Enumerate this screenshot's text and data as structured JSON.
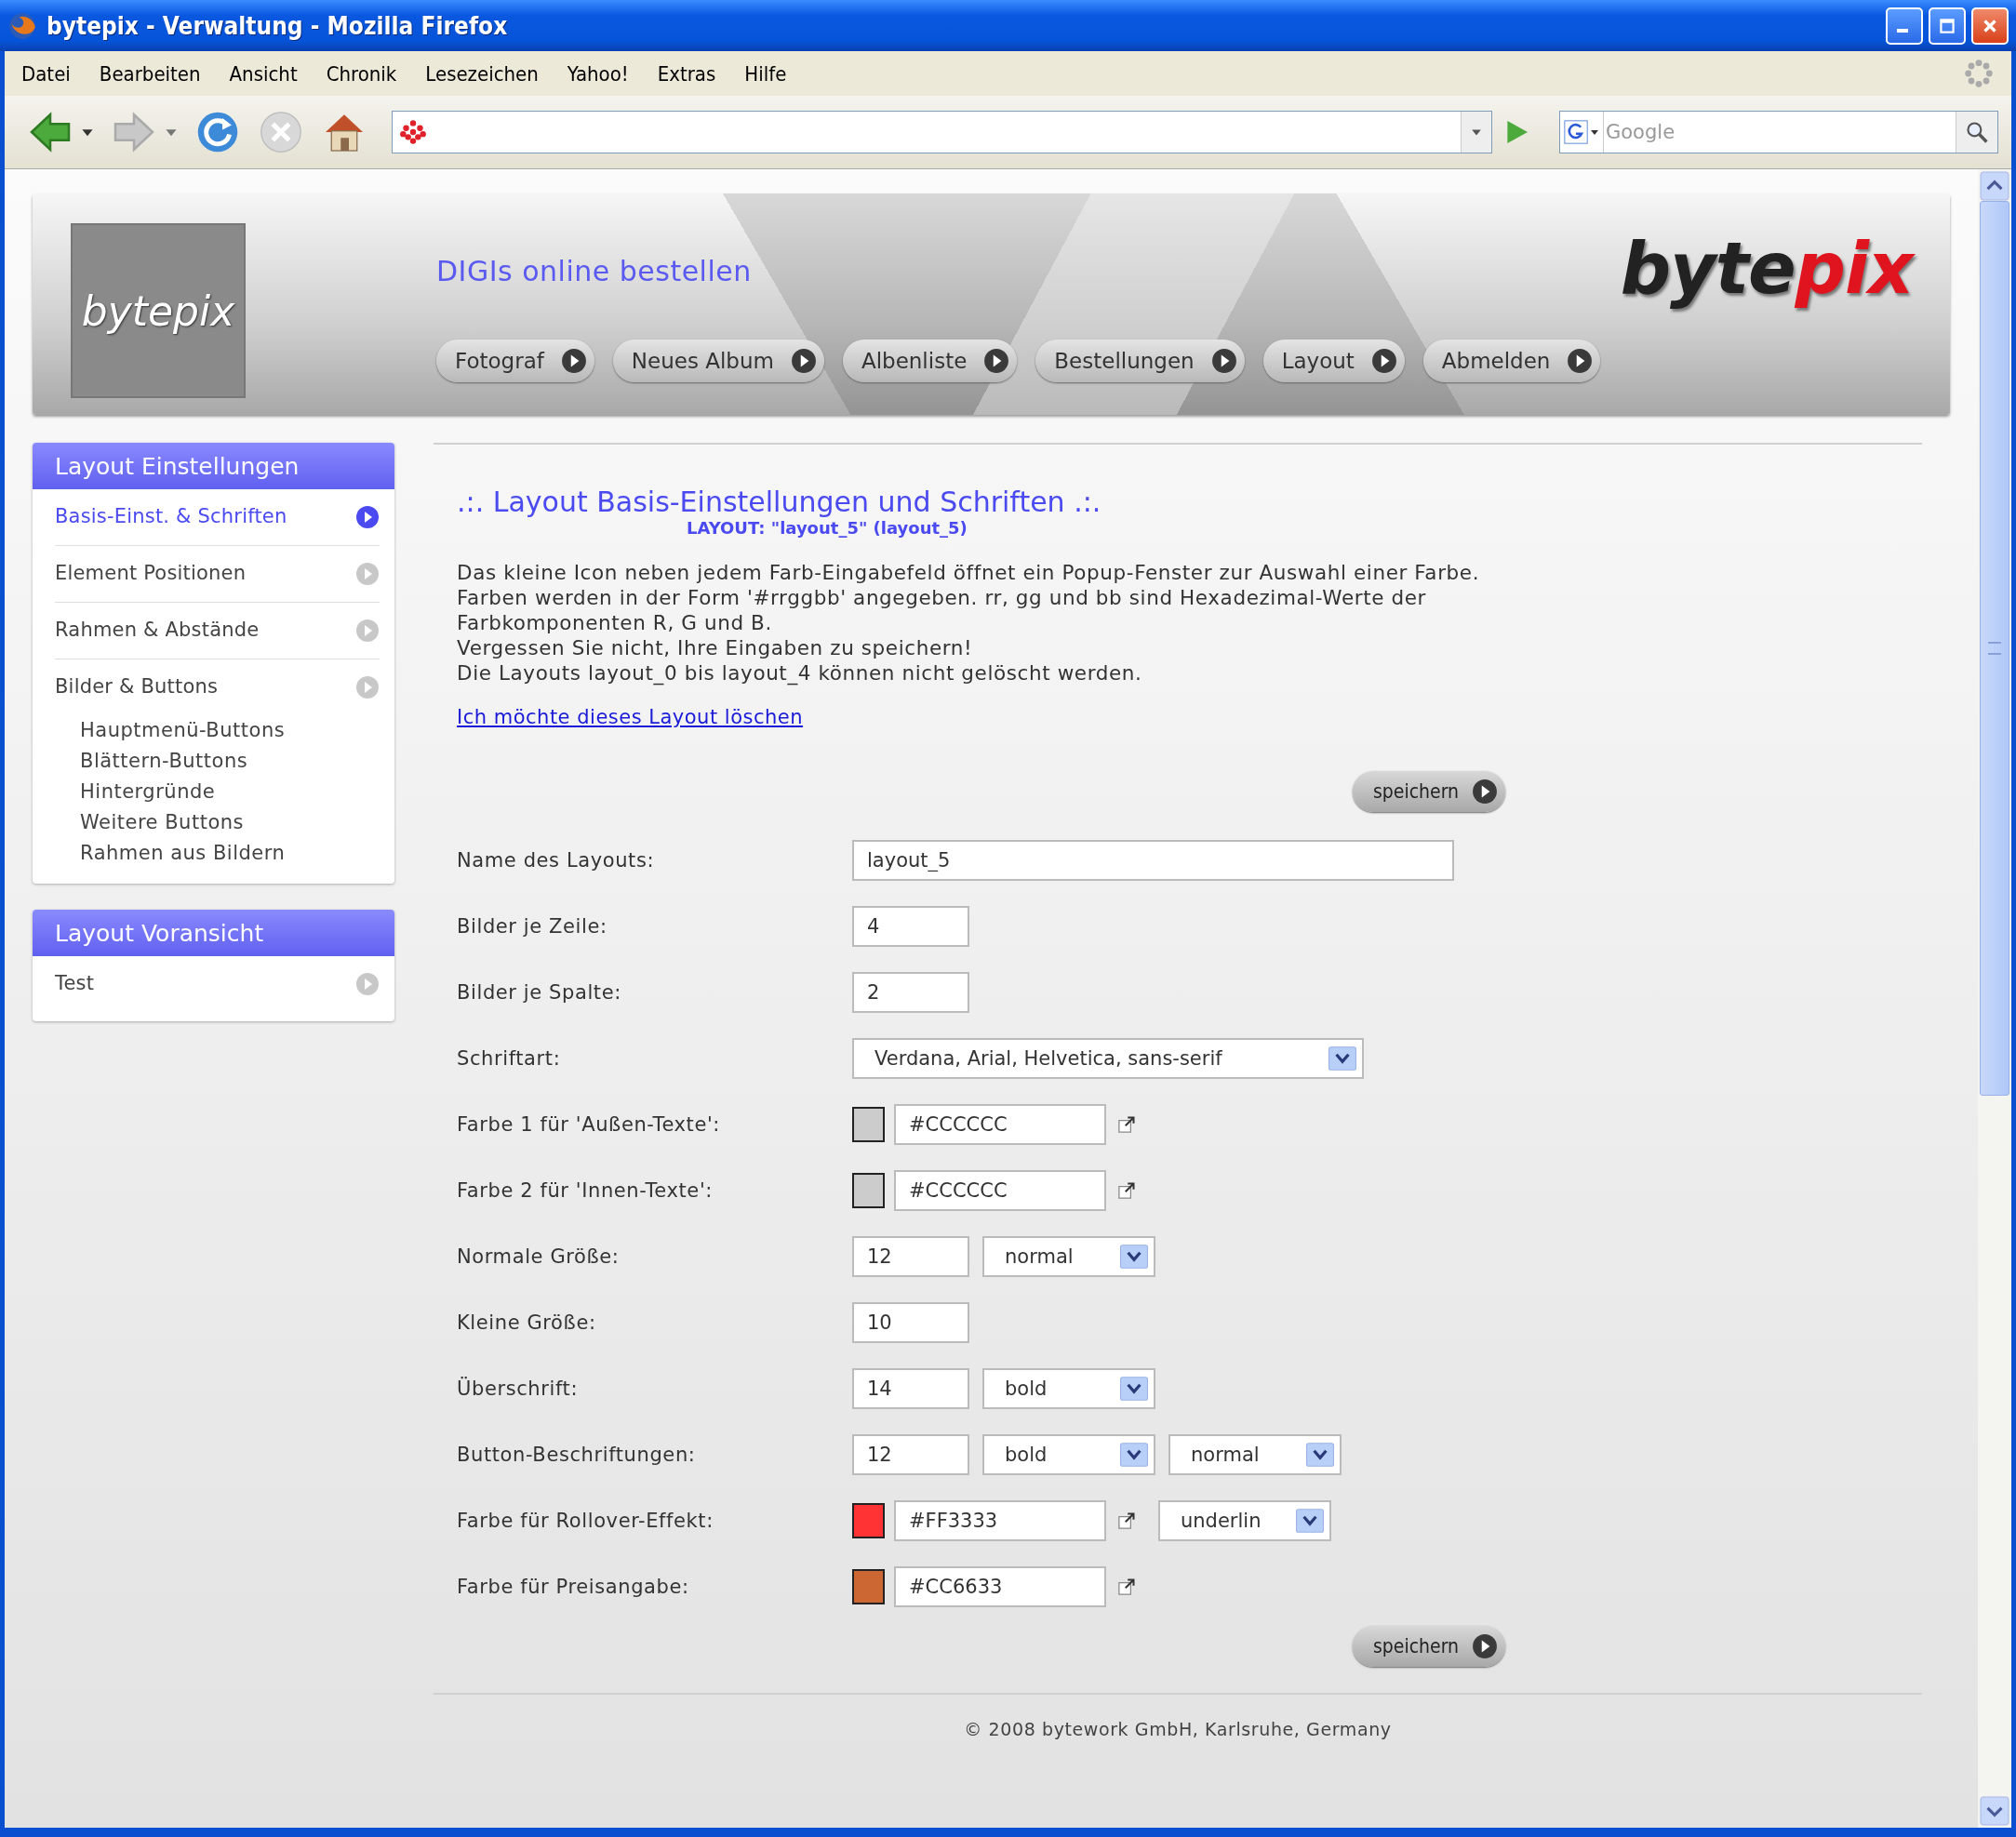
{
  "window": {
    "title": "bytepix - Verwaltung - Mozilla Firefox"
  },
  "menu": [
    "Datei",
    "Bearbeiten",
    "Ansicht",
    "Chronik",
    "Lesezeichen",
    "Yahoo!",
    "Extras",
    "Hilfe"
  ],
  "search": {
    "placeholder": "Google"
  },
  "header": {
    "logo_box": "bytepix",
    "tagline": "DIGIs online bestellen",
    "logo": {
      "dark": "byte",
      "accent": "pix"
    },
    "nav": [
      "Fotograf",
      "Neues Album",
      "Albenliste",
      "Bestellungen",
      "Layout",
      "Abmelden"
    ]
  },
  "sidebar": [
    {
      "title": "Layout Einstellungen",
      "items": [
        {
          "label": "Basis-Einst. & Schriften",
          "selected": true
        },
        {
          "label": "Element Positionen",
          "selected": false
        },
        {
          "label": "Rahmen & Abstände",
          "selected": false
        },
        {
          "label": "Bilder & Buttons",
          "selected": false,
          "children": [
            {
              "label": "Hauptmenü-Buttons",
              "selected": false
            },
            {
              "label": "Blättern-Buttons",
              "selected": false
            },
            {
              "label": "Hintergründe",
              "selected": false
            },
            {
              "label": "Weitere Buttons",
              "selected": false
            },
            {
              "label": "Rahmen aus Bildern",
              "selected": false
            }
          ]
        }
      ]
    },
    {
      "title": "Layout Voransicht",
      "items": [
        {
          "label": "Test",
          "selected": false
        }
      ]
    }
  ],
  "main": {
    "heading": ".:. Layout Basis-Einstellungen und Schriften .:.",
    "subheading": "LAYOUT: \"layout_5\" (layout_5)",
    "intro": [
      "Das kleine Icon neben jedem Farb-Eingabefeld öffnet ein Popup-Fenster zur Auswahl einer Farbe.",
      "Farben werden in der Form '#rrggbb' angegeben. rr, gg und bb sind Hexadezimal-Werte der",
      "Farbkomponenten R, G und B.",
      "Vergessen Sie nicht, Ihre Eingaben zu speichern!",
      "Die Layouts layout_0 bis layout_4 können nicht gelöscht werden."
    ],
    "delete_link": "Ich möchte dieses Layout löschen",
    "save_top": "speichern",
    "form": [
      {
        "label": "Name des Layouts:",
        "controls": [
          {
            "kind": "text",
            "value": "layout_5",
            "wide": true
          }
        ]
      },
      {
        "label": "Bilder je Zeile:",
        "controls": [
          {
            "kind": "text",
            "value": "4"
          }
        ]
      },
      {
        "label": "Bilder je Spalte:",
        "controls": [
          {
            "kind": "text",
            "value": "2"
          }
        ]
      },
      {
        "label": "Schriftart:",
        "controls": [
          {
            "kind": "select",
            "value": "Verdana, Arial, Helvetica, sans-serif",
            "wide": true
          }
        ]
      },
      {
        "label": "Farbe 1 für 'Außen-Texte':",
        "controls": [
          {
            "kind": "color",
            "color": "#cccccc",
            "value": "#CCCCCC"
          }
        ]
      },
      {
        "label": "Farbe 2 für 'Innen-Texte':",
        "controls": [
          {
            "kind": "color",
            "color": "#cccccc",
            "value": "#CCCCCC"
          }
        ]
      },
      {
        "label": "Normale Größe:",
        "controls": [
          {
            "kind": "text",
            "value": "12"
          },
          {
            "kind": "select",
            "value": "normal"
          }
        ]
      },
      {
        "label": "Kleine Größe:",
        "controls": [
          {
            "kind": "text",
            "value": "10"
          }
        ]
      },
      {
        "label": "Überschrift:",
        "controls": [
          {
            "kind": "text",
            "value": "14"
          },
          {
            "kind": "select",
            "value": "bold"
          }
        ]
      },
      {
        "label": "Button-Beschriftungen:",
        "controls": [
          {
            "kind": "text",
            "value": "12"
          },
          {
            "kind": "select",
            "value": "bold"
          },
          {
            "kind": "select",
            "value": "normal"
          }
        ]
      },
      {
        "label": "Farbe für Rollover-Effekt:",
        "controls": [
          {
            "kind": "color",
            "color": "#ff3333",
            "value": "#FF3333"
          },
          {
            "kind": "select",
            "value": "underlin"
          }
        ]
      },
      {
        "label": "Farbe für Preisangabe:",
        "controls": [
          {
            "kind": "color",
            "color": "#cc6633",
            "value": "#CC6633"
          }
        ]
      }
    ],
    "save_bottom": "speichern",
    "footer": "© 2008 bytework GmbH, Karlsruhe, Germany"
  }
}
